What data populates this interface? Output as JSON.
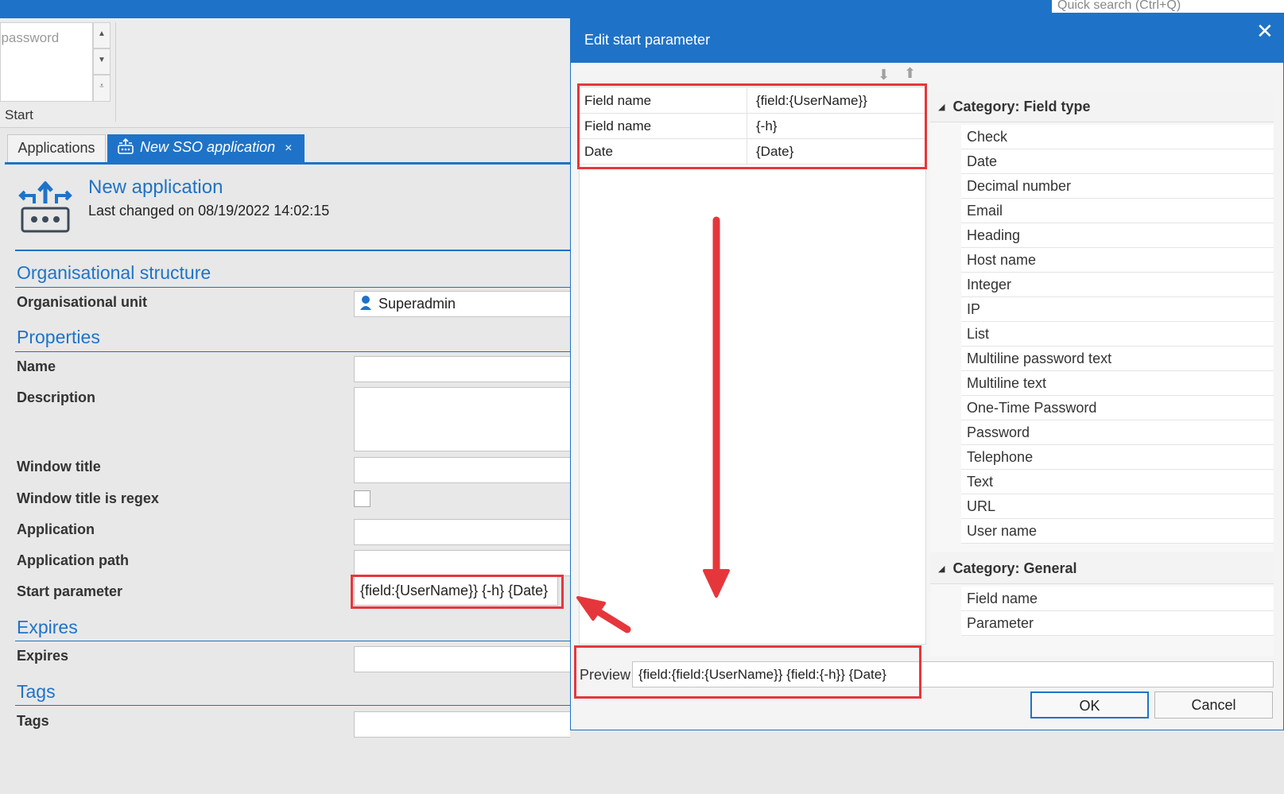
{
  "quick_search": {
    "placeholder": "Quick search (Ctrl+Q)"
  },
  "ribbon": {
    "list_item": "t password",
    "start_label": "Start"
  },
  "tabs": [
    {
      "label": "Applications"
    },
    {
      "label": "New SSO application",
      "close": "×"
    }
  ],
  "app": {
    "title": "New application",
    "last_changed": "Last changed on 08/19/2022 14:02:15"
  },
  "form": {
    "org_section": "Organisational structure",
    "org_unit_label": "Organisational unit",
    "org_unit_value": "Superadmin",
    "props_section": "Properties",
    "name_label": "Name",
    "description_label": "Description",
    "window_title_label": "Window title",
    "window_title_regex_label": "Window title is regex",
    "application_label": "Application",
    "application_path_label": "Application path",
    "start_parameter_label": "Start parameter",
    "start_parameter_value": "{field:{UserName}} {-h} {Date}",
    "expires_section": "Expires",
    "expires_label": "Expires",
    "tags_section": "Tags",
    "tags_label": "Tags"
  },
  "dialog": {
    "title": "Edit start parameter",
    "close": "✕",
    "parameters": [
      {
        "name": "Field name",
        "value": "{field:{UserName}}"
      },
      {
        "name": "Field name",
        "value": "{-h}"
      },
      {
        "name": "Date",
        "value": "{Date}"
      }
    ],
    "category_field_type": "Category: Field type",
    "field_types": [
      "Check",
      "Date",
      "Decimal number",
      "Email",
      "Heading",
      "Host name",
      "Integer",
      "IP",
      "List",
      "Multiline password text",
      "Multiline text",
      "One-Time Password",
      "Password",
      "Telephone",
      "Text",
      "URL",
      "User name"
    ],
    "category_general": "Category: General",
    "general_items": [
      "Field name",
      "Parameter"
    ],
    "preview_label": "Preview",
    "preview_value": "{field:{field:{UserName}} {field:{-h}} {Date}",
    "ok": "OK",
    "cancel": "Cancel"
  },
  "colors": {
    "accent": "#1e73c8",
    "highlight": "#e5373b"
  }
}
